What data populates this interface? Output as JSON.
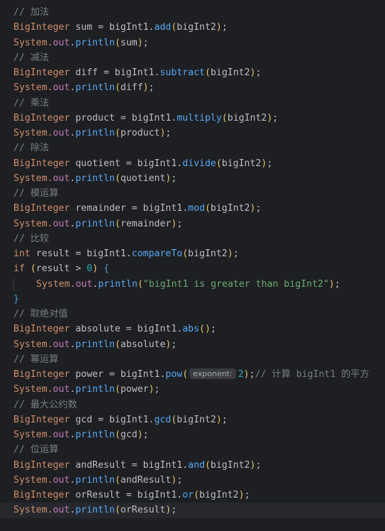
{
  "lines": [
    [
      {
        "t": "// 加法",
        "c": "cmt"
      }
    ],
    [
      {
        "t": "BigInteger",
        "c": "type"
      },
      {
        "t": " sum = bigInt1.",
        "c": "var"
      },
      {
        "t": "add",
        "c": "mth"
      },
      {
        "t": "(",
        "c": "p1"
      },
      {
        "t": "bigInt2",
        "c": "var"
      },
      {
        "t": ")",
        "c": "p1"
      },
      {
        "t": ";",
        "c": "var"
      }
    ],
    [
      {
        "t": "System.",
        "c": "type"
      },
      {
        "t": "out",
        "c": "fld"
      },
      {
        "t": ".",
        "c": "var"
      },
      {
        "t": "println",
        "c": "mth"
      },
      {
        "t": "(",
        "c": "p1"
      },
      {
        "t": "sum",
        "c": "var"
      },
      {
        "t": ")",
        "c": "p1"
      },
      {
        "t": ";",
        "c": "var"
      }
    ],
    [
      {
        "t": "// 减法",
        "c": "cmt"
      }
    ],
    [
      {
        "t": "BigInteger",
        "c": "type"
      },
      {
        "t": " diff = bigInt1.",
        "c": "var"
      },
      {
        "t": "subtract",
        "c": "mth"
      },
      {
        "t": "(",
        "c": "p1"
      },
      {
        "t": "bigInt2",
        "c": "var"
      },
      {
        "t": ")",
        "c": "p1"
      },
      {
        "t": ";",
        "c": "var"
      }
    ],
    [
      {
        "t": "System.",
        "c": "type"
      },
      {
        "t": "out",
        "c": "fld"
      },
      {
        "t": ".",
        "c": "var"
      },
      {
        "t": "println",
        "c": "mth"
      },
      {
        "t": "(",
        "c": "p1"
      },
      {
        "t": "diff",
        "c": "var"
      },
      {
        "t": ")",
        "c": "p1"
      },
      {
        "t": ";",
        "c": "var"
      }
    ],
    [
      {
        "t": "// 乘法",
        "c": "cmt"
      }
    ],
    [
      {
        "t": "BigInteger",
        "c": "type"
      },
      {
        "t": " product = bigInt1.",
        "c": "var"
      },
      {
        "t": "multiply",
        "c": "mth"
      },
      {
        "t": "(",
        "c": "p1"
      },
      {
        "t": "bigInt2",
        "c": "var"
      },
      {
        "t": ")",
        "c": "p1"
      },
      {
        "t": ";",
        "c": "var"
      }
    ],
    [
      {
        "t": "System.",
        "c": "type"
      },
      {
        "t": "out",
        "c": "fld"
      },
      {
        "t": ".",
        "c": "var"
      },
      {
        "t": "println",
        "c": "mth"
      },
      {
        "t": "(",
        "c": "p1"
      },
      {
        "t": "product",
        "c": "var"
      },
      {
        "t": ")",
        "c": "p1"
      },
      {
        "t": ";",
        "c": "var"
      }
    ],
    [
      {
        "t": "// 除法",
        "c": "cmt"
      }
    ],
    [
      {
        "t": "BigInteger",
        "c": "type"
      },
      {
        "t": " quotient = bigInt1.",
        "c": "var"
      },
      {
        "t": "divide",
        "c": "mth"
      },
      {
        "t": "(",
        "c": "p1"
      },
      {
        "t": "bigInt2",
        "c": "var"
      },
      {
        "t": ")",
        "c": "p1"
      },
      {
        "t": ";",
        "c": "var"
      }
    ],
    [
      {
        "t": "System.",
        "c": "type"
      },
      {
        "t": "out",
        "c": "fld"
      },
      {
        "t": ".",
        "c": "var"
      },
      {
        "t": "println",
        "c": "mth"
      },
      {
        "t": "(",
        "c": "p1"
      },
      {
        "t": "quotient",
        "c": "var"
      },
      {
        "t": ")",
        "c": "p1"
      },
      {
        "t": ";",
        "c": "var"
      }
    ],
    [
      {
        "t": "// 模运算",
        "c": "cmt"
      }
    ],
    [
      {
        "t": "BigInteger",
        "c": "type"
      },
      {
        "t": " remainder = bigInt1.",
        "c": "var"
      },
      {
        "t": "mod",
        "c": "mth"
      },
      {
        "t": "(",
        "c": "p1"
      },
      {
        "t": "bigInt2",
        "c": "var"
      },
      {
        "t": ")",
        "c": "p1"
      },
      {
        "t": ";",
        "c": "var"
      }
    ],
    [
      {
        "t": "System.",
        "c": "type"
      },
      {
        "t": "out",
        "c": "fld"
      },
      {
        "t": ".",
        "c": "var"
      },
      {
        "t": "println",
        "c": "mth"
      },
      {
        "t": "(",
        "c": "p1"
      },
      {
        "t": "remainder",
        "c": "var"
      },
      {
        "t": ")",
        "c": "p1"
      },
      {
        "t": ";",
        "c": "var"
      }
    ],
    [
      {
        "t": "// 比较",
        "c": "cmt"
      }
    ],
    [
      {
        "t": "int",
        "c": "kw"
      },
      {
        "t": " result = bigInt1.",
        "c": "var"
      },
      {
        "t": "compareTo",
        "c": "mth"
      },
      {
        "t": "(",
        "c": "p1"
      },
      {
        "t": "bigInt2",
        "c": "var"
      },
      {
        "t": ")",
        "c": "p1"
      },
      {
        "t": ";",
        "c": "var"
      }
    ],
    [
      {
        "t": "if",
        "c": "kw"
      },
      {
        "t": " ",
        "c": "var"
      },
      {
        "t": "(",
        "c": "p1"
      },
      {
        "t": "result > ",
        "c": "var"
      },
      {
        "t": "0",
        "c": "num"
      },
      {
        "t": ")",
        "c": "p1"
      },
      {
        "t": " ",
        "c": "var"
      },
      {
        "t": "{",
        "c": "p3"
      }
    ],
    [
      {
        "t": "System.",
        "c": "type"
      },
      {
        "t": "out",
        "c": "fld"
      },
      {
        "t": ".",
        "c": "var"
      },
      {
        "t": "println",
        "c": "mth"
      },
      {
        "t": "(",
        "c": "p1"
      },
      {
        "t": "\"bigInt1 is greater than bigInt2\"",
        "c": "str"
      },
      {
        "t": ")",
        "c": "p1"
      },
      {
        "t": ";",
        "c": "var"
      }
    ],
    [
      {
        "t": "}",
        "c": "p3"
      }
    ],
    [
      {
        "t": "// 取绝对值",
        "c": "cmt"
      }
    ],
    [
      {
        "t": "BigInteger",
        "c": "type"
      },
      {
        "t": " absolute = bigInt1.",
        "c": "var"
      },
      {
        "t": "abs",
        "c": "mth"
      },
      {
        "t": "(",
        "c": "p1"
      },
      {
        "t": ")",
        "c": "p1"
      },
      {
        "t": ";",
        "c": "var"
      }
    ],
    [
      {
        "t": "System.",
        "c": "type"
      },
      {
        "t": "out",
        "c": "fld"
      },
      {
        "t": ".",
        "c": "var"
      },
      {
        "t": "println",
        "c": "mth"
      },
      {
        "t": "(",
        "c": "p1"
      },
      {
        "t": "absolute",
        "c": "var"
      },
      {
        "t": ")",
        "c": "p1"
      },
      {
        "t": ";",
        "c": "var"
      }
    ],
    [
      {
        "t": "// 幂运算",
        "c": "cmt"
      }
    ],
    [
      {
        "t": "BigInteger",
        "c": "type"
      },
      {
        "t": " power = bigInt1.",
        "c": "var"
      },
      {
        "t": "pow",
        "c": "mth"
      },
      {
        "t": "(",
        "c": "p1"
      },
      {
        "t": "exponent:",
        "c": "hint"
      },
      {
        "t": "2",
        "c": "num"
      },
      {
        "t": ")",
        "c": "p1"
      },
      {
        "t": ";",
        "c": "var"
      },
      {
        "t": "// 计算 bigInt1 的平方",
        "c": "cmt"
      }
    ],
    [
      {
        "t": "System.",
        "c": "type"
      },
      {
        "t": "out",
        "c": "fld"
      },
      {
        "t": ".",
        "c": "var"
      },
      {
        "t": "println",
        "c": "mth"
      },
      {
        "t": "(",
        "c": "p1"
      },
      {
        "t": "power",
        "c": "var"
      },
      {
        "t": ")",
        "c": "p1"
      },
      {
        "t": ";",
        "c": "var"
      }
    ],
    [
      {
        "t": "// 最大公约数",
        "c": "cmt"
      }
    ],
    [
      {
        "t": "BigInteger",
        "c": "type"
      },
      {
        "t": " gcd = bigInt1.",
        "c": "var"
      },
      {
        "t": "gcd",
        "c": "mth"
      },
      {
        "t": "(",
        "c": "p1"
      },
      {
        "t": "bigInt2",
        "c": "var"
      },
      {
        "t": ")",
        "c": "p1"
      },
      {
        "t": ";",
        "c": "var"
      }
    ],
    [
      {
        "t": "System.",
        "c": "type"
      },
      {
        "t": "out",
        "c": "fld"
      },
      {
        "t": ".",
        "c": "var"
      },
      {
        "t": "println",
        "c": "mth"
      },
      {
        "t": "(",
        "c": "p1"
      },
      {
        "t": "gcd",
        "c": "var"
      },
      {
        "t": ")",
        "c": "p1"
      },
      {
        "t": ";",
        "c": "var"
      }
    ],
    [
      {
        "t": "// 位运算",
        "c": "cmt"
      }
    ],
    [
      {
        "t": "BigInteger",
        "c": "type"
      },
      {
        "t": " andResult = bigInt1.",
        "c": "var"
      },
      {
        "t": "and",
        "c": "mth"
      },
      {
        "t": "(",
        "c": "p1"
      },
      {
        "t": "bigInt2",
        "c": "var"
      },
      {
        "t": ")",
        "c": "p1"
      },
      {
        "t": ";",
        "c": "var"
      }
    ],
    [
      {
        "t": "System.",
        "c": "type"
      },
      {
        "t": "out",
        "c": "fld"
      },
      {
        "t": ".",
        "c": "var"
      },
      {
        "t": "println",
        "c": "mth"
      },
      {
        "t": "(",
        "c": "p1"
      },
      {
        "t": "andResult",
        "c": "var"
      },
      {
        "t": ")",
        "c": "p1"
      },
      {
        "t": ";",
        "c": "var"
      }
    ],
    [
      {
        "t": "BigInteger",
        "c": "type"
      },
      {
        "t": " orResult = bigInt1.",
        "c": "var"
      },
      {
        "t": "or",
        "c": "mth"
      },
      {
        "t": "(",
        "c": "p1"
      },
      {
        "t": "bigInt2",
        "c": "var"
      },
      {
        "t": ")",
        "c": "p1"
      },
      {
        "t": ";",
        "c": "var"
      }
    ],
    [
      {
        "t": "System.",
        "c": "type"
      },
      {
        "t": "out",
        "c": "fld"
      },
      {
        "t": ".",
        "c": "var"
      },
      {
        "t": "println",
        "c": "mth"
      },
      {
        "t": "(",
        "c": "p1"
      },
      {
        "t": "orResult",
        "c": "var"
      },
      {
        "t": ")",
        "c": "p1"
      },
      {
        "t": ";",
        "c": "var"
      }
    ]
  ],
  "indented_lines": [
    18
  ],
  "current_line": 33,
  "colors": {
    "background": "#1e1f22",
    "comment": "#7a7e85",
    "keyword": "#cf8e6d",
    "method": "#56a8f5",
    "field": "#c77dbb",
    "number": "#2aacb8",
    "string": "#6aab73",
    "text": "#bcbec4"
  }
}
